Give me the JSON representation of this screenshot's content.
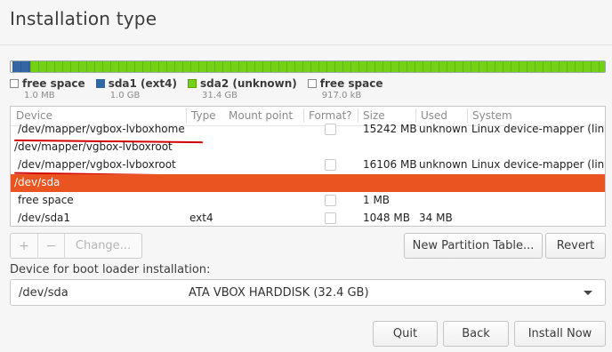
{
  "title": "Installation type",
  "legend": [
    {
      "label": "free space",
      "size": "1.0 MB",
      "color": "#ffffff"
    },
    {
      "label": "sda1 (ext4)",
      "size": "1.0 GB",
      "color": "#3465a4"
    },
    {
      "label": "sda2 (unknown)",
      "size": "31.4 GB",
      "color": "#73d216"
    },
    {
      "label": "free space",
      "size": "917.0 kB",
      "color": "#ffffff"
    }
  ],
  "table": {
    "headers": [
      "Device",
      "Type",
      "Mount point",
      "Format?",
      "Size",
      "Used",
      "System"
    ],
    "rows": [
      {
        "device": "/dev/mapper/vgbox-lvboxhome",
        "type": "",
        "mount": "",
        "format": false,
        "size": "15242 MB",
        "used": "unknown",
        "system": "Linux device-mapper (line"
      },
      {
        "device": "/dev/mapper/vgbox-lvboxroot",
        "type": "",
        "mount": "",
        "format": null,
        "size": "",
        "used": "",
        "system": ""
      },
      {
        "device": "/dev/mapper/vgbox-lvboxroot",
        "type": "",
        "mount": "",
        "format": false,
        "size": "16106 MB",
        "used": "unknown",
        "system": "Linux device-mapper (line"
      },
      {
        "device": "/dev/sda",
        "type": "",
        "mount": "",
        "format": null,
        "size": "",
        "used": "",
        "system": "",
        "selected": true
      },
      {
        "device": "free space",
        "type": "",
        "mount": "",
        "format": false,
        "size": "1 MB",
        "used": "",
        "system": ""
      },
      {
        "device": "/dev/sda1",
        "type": "ext4",
        "mount": "",
        "format": false,
        "size": "1048 MB",
        "used": "34 MB",
        "system": ""
      }
    ]
  },
  "toolbar": {
    "add": "+",
    "remove": "−",
    "change": "Change...",
    "new_table": "New Partition Table...",
    "revert": "Revert"
  },
  "boot": {
    "label": "Device for boot loader installation:",
    "device": "/dev/sda",
    "description": "ATA VBOX HARDDISK (32.4 GB)"
  },
  "footer": {
    "quit": "Quit",
    "back": "Back",
    "install": "Install Now"
  },
  "colors": {
    "accent": "#e95420",
    "annotation": "#d40000"
  }
}
